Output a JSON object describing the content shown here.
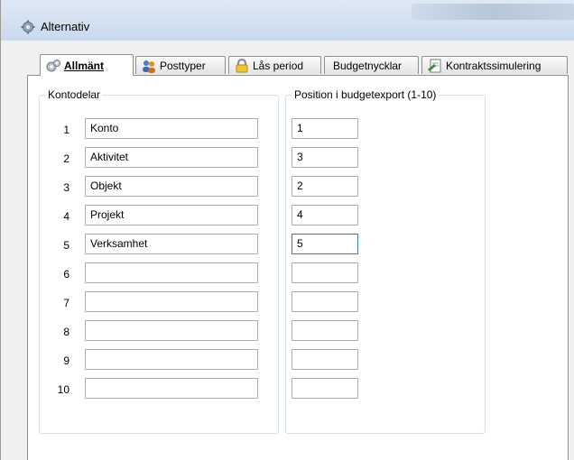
{
  "window": {
    "title": "Alternativ"
  },
  "tabs": [
    {
      "label": "Allmänt",
      "icon": "gears-icon",
      "active": true
    },
    {
      "label": "Posttyper",
      "icon": "people-icon"
    },
    {
      "label": "Lås period",
      "icon": "lock-icon"
    },
    {
      "label": "Budgetnycklar",
      "icon": ""
    },
    {
      "label": "Kontraktssimulering",
      "icon": "document-icon"
    }
  ],
  "kontodelar": {
    "title": "Kontodelar",
    "rows": [
      {
        "num": "1",
        "value": "Konto"
      },
      {
        "num": "2",
        "value": "Aktivitet"
      },
      {
        "num": "3",
        "value": "Objekt"
      },
      {
        "num": "4",
        "value": "Projekt"
      },
      {
        "num": "5",
        "value": "Verksamhet"
      },
      {
        "num": "6",
        "value": ""
      },
      {
        "num": "7",
        "value": ""
      },
      {
        "num": "8",
        "value": ""
      },
      {
        "num": "9",
        "value": ""
      },
      {
        "num": "10",
        "value": ""
      }
    ]
  },
  "position": {
    "title": "Position i budgetexport (1-10)",
    "values": [
      "1",
      "3",
      "2",
      "4",
      "5",
      "",
      "",
      "",
      "",
      ""
    ]
  },
  "colors": {
    "focus_border": "#3d7bad",
    "field_border": "#abadb3"
  }
}
